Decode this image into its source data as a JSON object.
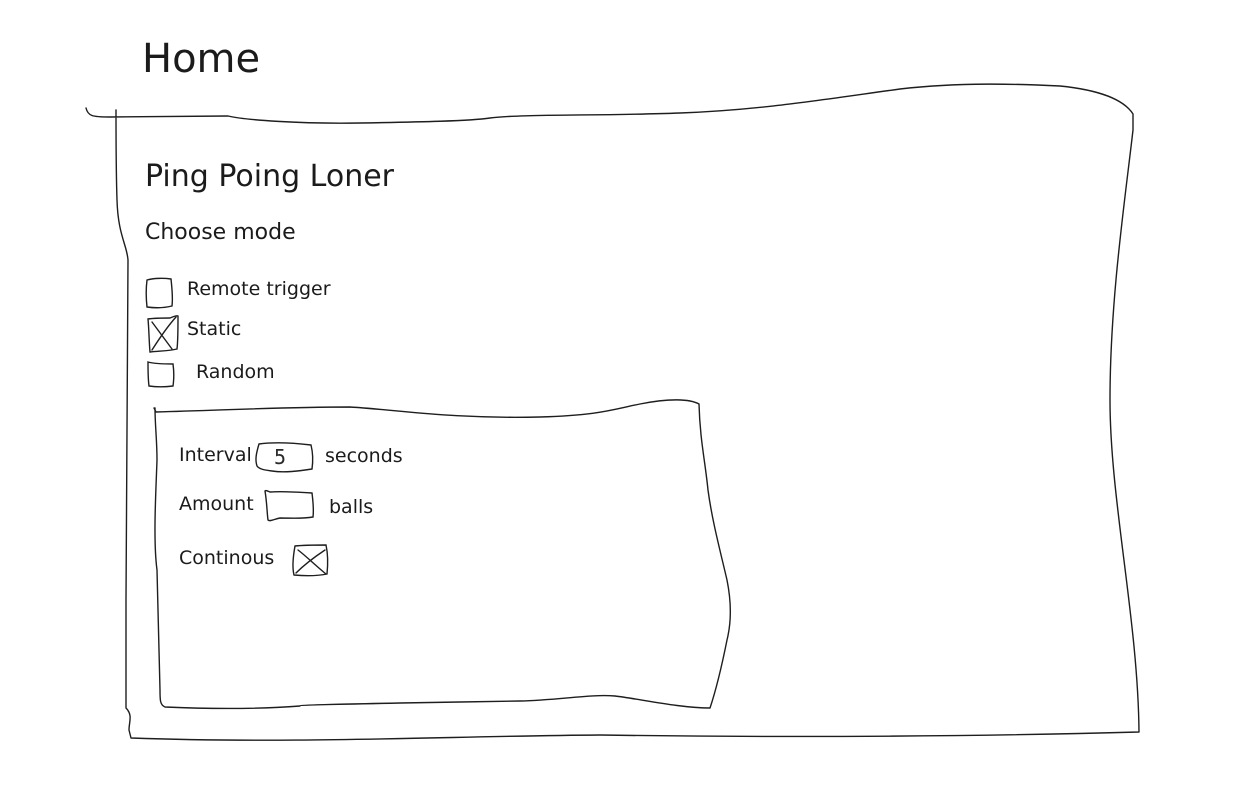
{
  "page": {
    "title": "Home"
  },
  "app": {
    "title": "Ping Poing Loner"
  },
  "mode": {
    "heading": "Choose mode",
    "options": [
      {
        "label": "Remote trigger",
        "checked": false
      },
      {
        "label": "Static",
        "checked": true
      },
      {
        "label": "Random",
        "checked": false
      }
    ]
  },
  "settings": {
    "interval": {
      "label": "Interval",
      "value": "5",
      "unit": "seconds"
    },
    "amount": {
      "label": "Amount",
      "value": "",
      "unit": "balls"
    },
    "continuous": {
      "label": "Continous",
      "checked": true
    }
  }
}
